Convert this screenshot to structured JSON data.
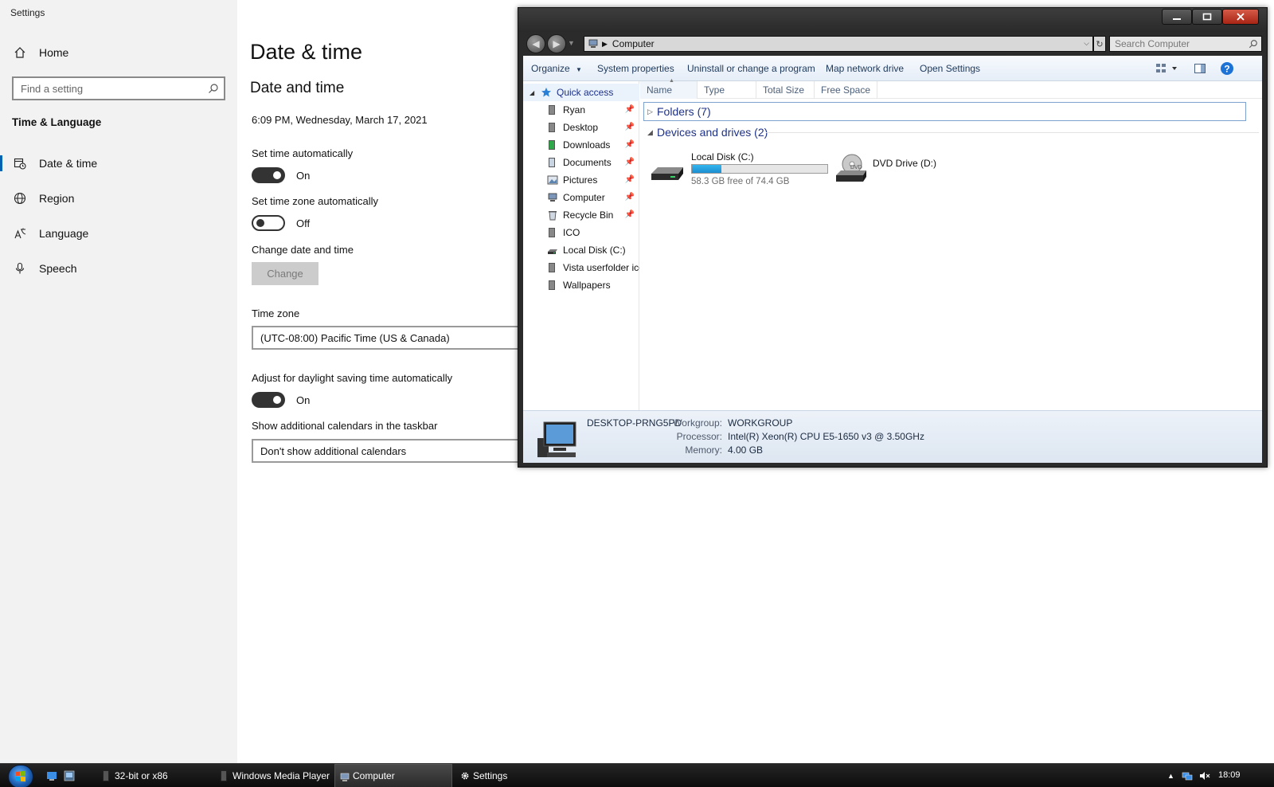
{
  "settings": {
    "window_title": "Settings",
    "nav": {
      "home_label": "Home",
      "search_placeholder": "Find a setting",
      "section_title": "Time & Language",
      "items": [
        {
          "label": "Date & time",
          "icon": "calendar-clock-icon",
          "active": true
        },
        {
          "label": "Region",
          "icon": "globe-icon",
          "active": false
        },
        {
          "label": "Language",
          "icon": "language-icon",
          "active": false
        },
        {
          "label": "Speech",
          "icon": "microphone-icon",
          "active": false
        }
      ]
    },
    "main": {
      "page_title": "Date & time",
      "subheading": "Date and time",
      "current_datetime": "6:09 PM, Wednesday, March 17, 2021",
      "set_time_auto": {
        "label": "Set time automatically",
        "state": "On"
      },
      "set_timezone_auto": {
        "label": "Set time zone automatically",
        "state": "Off"
      },
      "change_date_time": {
        "label": "Change date and time",
        "button": "Change"
      },
      "time_zone": {
        "label": "Time zone",
        "value": "(UTC-08:00) Pacific Time (US & Canada)"
      },
      "daylight_saving": {
        "label": "Adjust for daylight saving time automatically",
        "state": "On"
      },
      "additional_calendars": {
        "label": "Show additional calendars in the taskbar",
        "value": "Don't show additional calendars"
      }
    }
  },
  "explorer": {
    "address": "Computer",
    "search_placeholder": "Search Computer",
    "toolbar": {
      "organize": "Organize",
      "system_properties": "System properties",
      "uninstall": "Uninstall or change a program",
      "map_drive": "Map network drive",
      "open_settings": "Open Settings"
    },
    "nav_pane": [
      {
        "label": "Quick access",
        "icon": "star-icon",
        "pinned": false
      },
      {
        "label": "Ryan",
        "icon": "user-folder-icon",
        "pinned": true
      },
      {
        "label": "Desktop",
        "icon": "desktop-folder-icon",
        "pinned": true
      },
      {
        "label": "Downloads",
        "icon": "downloads-folder-icon",
        "pinned": true
      },
      {
        "label": "Documents",
        "icon": "documents-folder-icon",
        "pinned": true
      },
      {
        "label": "Pictures",
        "icon": "pictures-folder-icon",
        "pinned": true
      },
      {
        "label": "Computer",
        "icon": "computer-icon",
        "pinned": true
      },
      {
        "label": "Recycle Bin",
        "icon": "recycle-bin-icon",
        "pinned": true
      },
      {
        "label": "ICO",
        "icon": "folder-icon",
        "pinned": false
      },
      {
        "label": "Local Disk (C:)",
        "icon": "disk-icon",
        "pinned": false
      },
      {
        "label": "Vista userfolder icons",
        "icon": "folder-icon",
        "pinned": false
      },
      {
        "label": "Wallpapers",
        "icon": "folder-icon",
        "pinned": false
      }
    ],
    "columns": [
      "Name",
      "Type",
      "Total Size",
      "Free Space"
    ],
    "groups": {
      "folders": "Folders (7)",
      "devices": "Devices and drives (2)"
    },
    "drives": [
      {
        "name": "Local Disk (C:)",
        "free_text": "58.3 GB free of 74.4 GB",
        "used_fraction": 0.22
      },
      {
        "name": "DVD Drive (D:)"
      }
    ],
    "details": {
      "computer_name": "DESKTOP-PRNG5PD",
      "workgroup_key": "Workgroup:",
      "workgroup_val": "WORKGROUP",
      "processor_key": "Processor:",
      "processor_val": "Intel(R) Xeon(R) CPU E5-1650 v3 @ 3.50GHz",
      "memory_key": "Memory:",
      "memory_val": "4.00 GB"
    }
  },
  "taskbar": {
    "tasks": [
      {
        "label": "32-bit or x86",
        "icon": "folder-icon"
      },
      {
        "label": "Windows Media Player",
        "icon": "folder-icon"
      },
      {
        "label": "Computer",
        "icon": "computer-icon"
      },
      {
        "label": "Settings",
        "icon": "gear-icon"
      }
    ],
    "clock": "18:09"
  },
  "colors": {
    "accent": "#0063b1",
    "explorer_link": "#1e3287",
    "drive_bar": "#26a0da"
  }
}
